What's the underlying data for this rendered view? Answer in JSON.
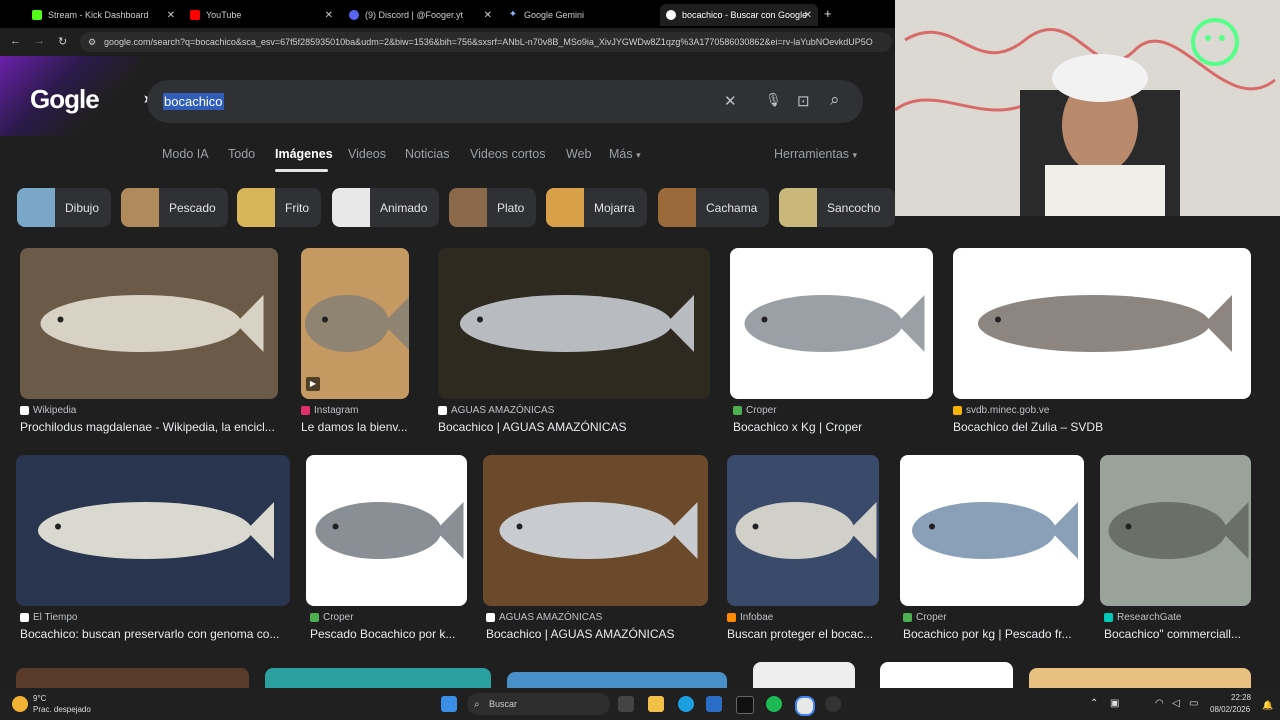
{
  "tabs": [
    {
      "label": "Stream - Kick Dashboard",
      "color": "#53fc18"
    },
    {
      "label": "YouTube",
      "color": "#ff0000"
    },
    {
      "label": "(9) Discord | @Fooger.yt",
      "color": "#5865f2"
    },
    {
      "label": "Google Gemini",
      "color": "#8ab4f8"
    },
    {
      "label": "bocachico - Buscar con Google",
      "color": "#ffffff"
    }
  ],
  "new_tab": "+",
  "nav": {
    "back": "←",
    "forward": "→",
    "reload": "↻"
  },
  "address": "google.com/search?q=bocachico&sca_esv=67f5f285935010ba&udm=2&biw=1536&bih=756&sxsrf=ANbL-n70v8B_MSo9ia_XivJYGWDw8Z1qzg%3A1770586030862&ei=rv-laYubNOevkdUP5O",
  "logo": "Gogle",
  "search": {
    "query": "bocachico",
    "clear": "✕",
    "mic": "🎙",
    "lens": "⊡",
    "search": "⌕"
  },
  "search_tabs": [
    {
      "label": "Modo IA"
    },
    {
      "label": "Todo"
    },
    {
      "label": "Imágenes"
    },
    {
      "label": "Videos"
    },
    {
      "label": "Noticias"
    },
    {
      "label": "Videos cortos"
    },
    {
      "label": "Web"
    },
    {
      "label": "Más"
    }
  ],
  "more_arrow": "▾",
  "tools": "Herramientas",
  "chips": [
    {
      "label": "Dibujo",
      "color": "#7aa7c7"
    },
    {
      "label": "Pescado",
      "color": "#b08a5a"
    },
    {
      "label": "Frito",
      "color": "#d9b55a"
    },
    {
      "label": "Animado",
      "color": "#e8e8e8"
    },
    {
      "label": "Plato",
      "color": "#8a6a4a"
    },
    {
      "label": "Mojarra",
      "color": "#d9a04a"
    },
    {
      "label": "Cachama",
      "color": "#9a6a3a"
    },
    {
      "label": "Sancocho",
      "color": "#c9b87a"
    }
  ],
  "results_row1": [
    {
      "source": "Wikipedia",
      "title": "Prochilodus magdalenae - Wikipedia, la encicl...",
      "src_color": "#ffffff",
      "bg": "#6b5a48",
      "fish": "#d8d2c4"
    },
    {
      "source": "Instagram",
      "title": "Le damos la bienv...",
      "src_color": "#e1306c",
      "bg": "#c49a62",
      "fish": "#8f8372"
    },
    {
      "source": "AGUAS AMAZÓNICAS",
      "title": "Bocachico | AGUAS AMAZÓNICAS",
      "src_color": "#ffffff",
      "bg": "#2e2a20",
      "fish": "#b8bcc0"
    },
    {
      "source": "Croper",
      "title": "Bocachico x Kg | Croper",
      "src_color": "#4caf50",
      "bg": "#ffffff",
      "fish": "#9aa0a6"
    },
    {
      "source": "svdb.minec.gob.ve",
      "title": "Bocachico del Zulia – SVDB",
      "src_color": "#f4b400",
      "bg": "#ffffff",
      "fish": "#8d8680"
    }
  ],
  "results_row2": [
    {
      "source": "El Tiempo",
      "title": "Bocachico: buscan preservarlo con genoma co...",
      "src_color": "#ffffff",
      "bg": "#2a3550",
      "fish": "#d9d9cf"
    },
    {
      "source": "Croper",
      "title": "Pescado Bocachico por k...",
      "src_color": "#4caf50",
      "bg": "#ffffff",
      "fish": "#8a8f95"
    },
    {
      "source": "AGUAS AMAZÓNICAS",
      "title": "Bocachico | AGUAS AMAZÓNICAS",
      "src_color": "#ffffff",
      "bg": "#6a4a2a",
      "fish": "#c8ccd0"
    },
    {
      "source": "Infobae",
      "title": "Buscan proteger el bocac...",
      "src_color": "#ff8c00",
      "bg": "#3a4a6a",
      "fish": "#d0d0c8"
    },
    {
      "source": "Croper",
      "title": "Bocachico por kg | Pescado fr...",
      "src_color": "#4caf50",
      "bg": "#ffffff",
      "fish": "#8aa0b8"
    },
    {
      "source": "ResearchGate",
      "title": "Bocachico\" commerciall...",
      "src_color": "#00ccbb",
      "bg": "#9aa39a",
      "fish": "#6a7068"
    }
  ],
  "weather": {
    "temp": "9°C",
    "desc": "Prac. despejado"
  },
  "taskbar_search": "Buscar",
  "clock": {
    "time": "22:28",
    "date": "08/02/2026"
  }
}
